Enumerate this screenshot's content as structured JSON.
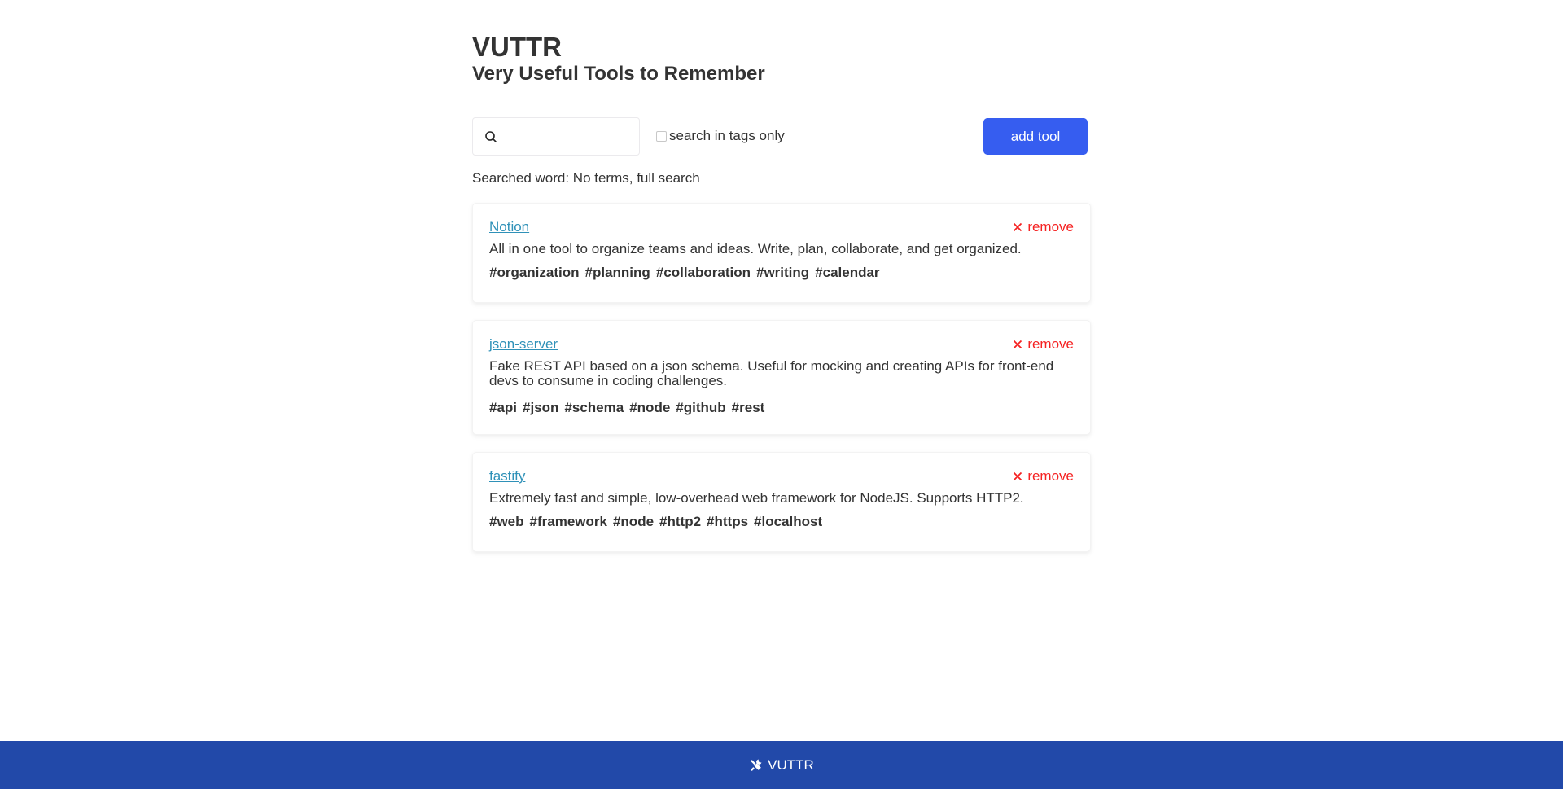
{
  "app": {
    "title": "VUTTR",
    "subtitle": "Very Useful Tools to Remember"
  },
  "search": {
    "value": "",
    "placeholder": "",
    "icon": "search-icon",
    "tags_only_label": "search in tags only",
    "tags_only_checked": false,
    "status": "Searched word: No terms, full search"
  },
  "toolbar": {
    "add_label": "add tool"
  },
  "tools": [
    {
      "name": "Notion",
      "description": "All in one tool to organize teams and ideas. Write, plan, collaborate, and get organized.",
      "tags": [
        "#organization",
        "#planning",
        "#collaboration",
        "#writing",
        "#calendar"
      ],
      "remove_label": "remove"
    },
    {
      "name": "json-server",
      "description": "Fake REST API based on a json schema. Useful for mocking and creating APIs for front-end devs to consume in coding challenges.",
      "tags": [
        "#api",
        "#json",
        "#schema",
        "#node",
        "#github",
        "#rest"
      ],
      "remove_label": "remove"
    },
    {
      "name": "fastify",
      "description": "Extremely fast and simple, low-overhead web framework for NodeJS. Supports HTTP2.",
      "tags": [
        "#web",
        "#framework",
        "#node",
        "#http2",
        "#https",
        "#localhost"
      ],
      "remove_label": "remove"
    }
  ],
  "footer": {
    "icon": "tools-icon",
    "label": "VUTTR"
  },
  "colors": {
    "primary": "#365df0",
    "footer": "#2249a9",
    "link": "#2f91b8",
    "danger": "#f52121",
    "text": "#333333"
  }
}
